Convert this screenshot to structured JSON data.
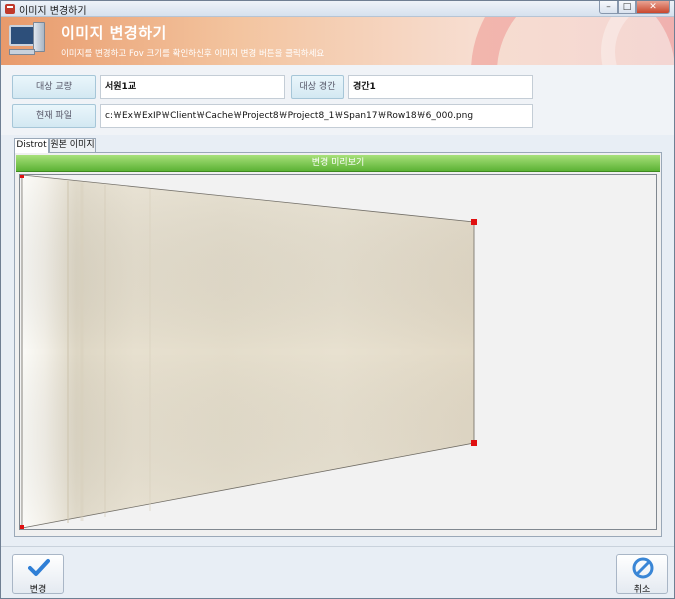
{
  "window": {
    "title": "이미지 변경하기",
    "controls": {
      "minimize": "–",
      "maximize": "□",
      "close": "✕"
    }
  },
  "banner": {
    "title": "이미지 변경하기",
    "subtitle": "이미지를 변경하고 Fov 크기를 확인하신후 이미지 변경 버튼을 클릭하세요",
    "icon": "computer-icon"
  },
  "form": {
    "bridge_label": "대상 교량",
    "bridge_value": "서원1교",
    "span_label": "대상 경간",
    "span_value": "경간1",
    "file_label": "현재 파일",
    "file_value": "c:￦Ex￦ExIP￦Client￦Cache￦Project8￦Project8_1￦Span17￦Row18￦6_000.png"
  },
  "tabs": [
    {
      "label": "Distrot",
      "active": true
    },
    {
      "label": "원본 이미지",
      "active": false
    }
  ],
  "preview": {
    "header": "변경 미리보기",
    "handle_color": "#e01010"
  },
  "buttons": {
    "apply_label": "변경",
    "apply_icon": "checkmark-icon",
    "cancel_label": "취소",
    "cancel_icon": "cancel-icon"
  },
  "colors": {
    "banner_title": "#ffffff",
    "preview_header": "#5cb235",
    "apply_icon": "#2f7fd6",
    "cancel_icon": "#3a86d6"
  }
}
